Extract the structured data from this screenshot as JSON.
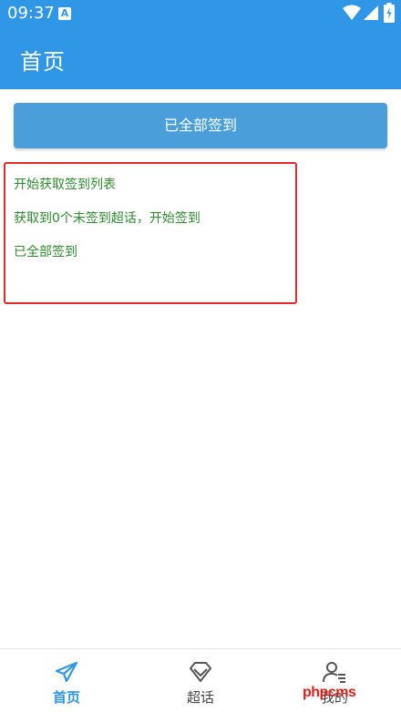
{
  "status_bar": {
    "time": "09:37",
    "app_icon_letter": "A"
  },
  "header": {
    "title": "首页"
  },
  "main": {
    "sign_all_button_label": "已全部签到",
    "log_lines": [
      "开始获取签到列表",
      "获取到0个未签到超话，开始签到",
      "已全部签到"
    ]
  },
  "bottom_nav": {
    "items": [
      {
        "label": "首页",
        "icon": "paper-plane-icon",
        "active": true
      },
      {
        "label": "超话",
        "icon": "diamond-icon",
        "active": false
      },
      {
        "label": "我的",
        "icon": "user-list-icon",
        "active": false
      }
    ]
  },
  "watermark": {
    "text": "phpcms"
  },
  "colors": {
    "primary": "#2f97e6",
    "button": "#4a9fdb",
    "log_text": "#2e8a2e",
    "highlight_border": "#e02b2b",
    "watermark": "#e0201a"
  }
}
